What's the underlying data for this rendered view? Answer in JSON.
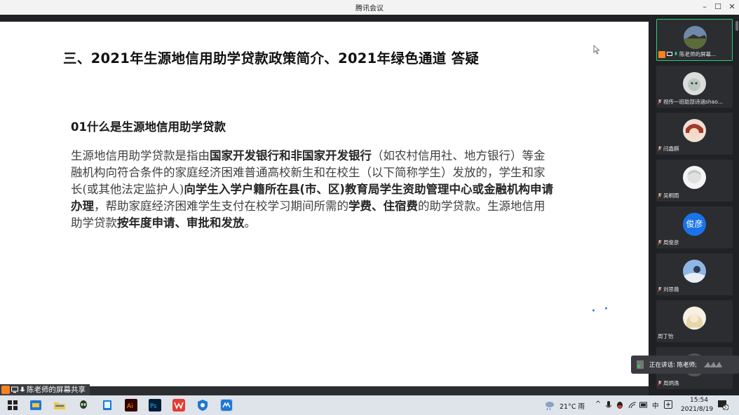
{
  "window": {
    "title": "腾讯会议"
  },
  "slide": {
    "title": "三、2021年生源地信用助学贷款政策简介、2021年绿色通道 答疑",
    "subtitle": "01什么是生源地信用助学贷款",
    "body": [
      {
        "t": "生源地信用助学贷款是指由",
        "b": false
      },
      {
        "t": "国家开发银行和非国家开发银行",
        "b": true
      },
      {
        "t": "（如农村信用社、地方银行）等金融机构向",
        "b": false
      },
      {
        "t": "符合条件的家庭经济困难普通高校新生和在校生",
        "b": false
      },
      {
        "t": "（以下简称学生）发放的，学生和家长(或其他法定监护人)",
        "b": false
      },
      {
        "t": "向学生入学户籍所在县(市、区)教育局学生资助管理中心或金融机构申请办理",
        "b": true
      },
      {
        "t": "，帮助家庭经济困难学生支付在校学习期间所需的",
        "b": false
      },
      {
        "t": "学费、住宿费",
        "b": true
      },
      {
        "t": "的助学贷款。生源地信用助学贷款",
        "b": false
      },
      {
        "t": "按年度申请、审批和发放",
        "b": true
      },
      {
        "t": "。",
        "b": false
      }
    ]
  },
  "share_label": "陈老师的屏幕共享",
  "participants": [
    {
      "name": "陈老师的屏幕...",
      "avatar": "landscape",
      "active": true
    },
    {
      "name": "视传一班助部诗涵shao...",
      "avatar": "cat"
    },
    {
      "name": "闫鑫麒",
      "avatar": "anime"
    },
    {
      "name": "吴桐雨",
      "avatar": "white"
    },
    {
      "name": "周俊彦",
      "avatar": "text",
      "avatar_text": "俊彦"
    },
    {
      "name": "刘思薇",
      "avatar": "sky"
    },
    {
      "name": "周丁怡",
      "avatar": "girl"
    },
    {
      "name": "周炳逸",
      "avatar": "dark"
    }
  ],
  "speaking": {
    "label": "正在讲话: 陈老师;"
  },
  "taskbar": {
    "weather": "21°C 雨",
    "ime_lang": "中",
    "time": "15:54",
    "date": "2021/8/19",
    "notification_count": "5",
    "apps": [
      "windows-start",
      "weather-app",
      "file-explorer",
      "alien-app",
      "tablet-app",
      "illustrator",
      "photoshop",
      "wps",
      "security-app",
      "tencent-meeting"
    ]
  },
  "colors": {
    "accent": "#2ecc71",
    "avatar_blue": "#1a73e8",
    "cursor_orange": "#f58220"
  }
}
